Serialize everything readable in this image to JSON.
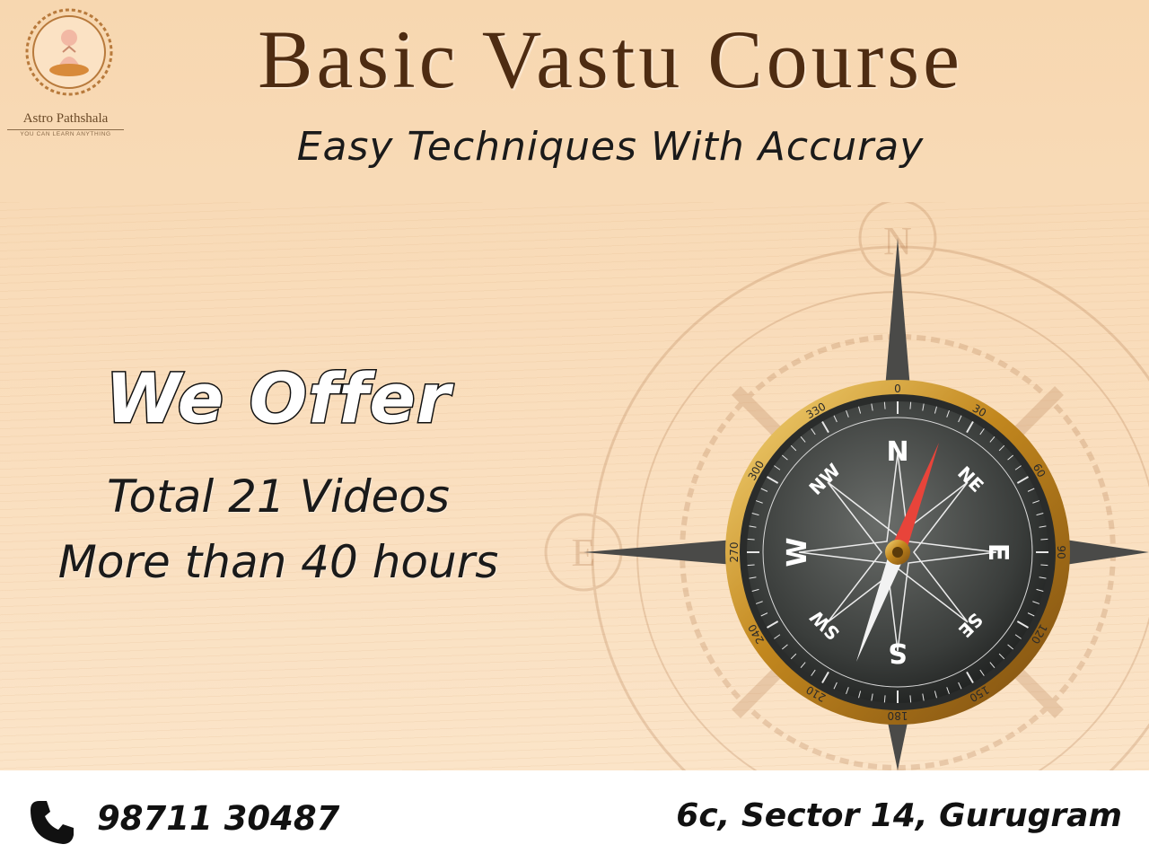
{
  "brand": {
    "name": "Astro Pathshala",
    "tagline": "YOU CAN LEARN ANYTHING"
  },
  "header": {
    "title": "Basic Vastu Course",
    "subtitle": "Easy Techniques With Accuray"
  },
  "offer": {
    "heading": "We Offer",
    "lines": [
      "Total 21 Videos",
      "More than 40 hours"
    ]
  },
  "compass": {
    "directions": [
      "N",
      "NE",
      "E",
      "SE",
      "S",
      "SW",
      "W",
      "NW"
    ],
    "degree_labels": [
      "0",
      "30",
      "60",
      "90",
      "120",
      "150",
      "180",
      "210",
      "240",
      "270",
      "300",
      "330"
    ],
    "background_letters": [
      "N",
      "E"
    ]
  },
  "footer": {
    "phone": "98711 30487",
    "address": "6c, Sector 14, Gurugram",
    "phone_icon": "phone-icon"
  },
  "colors": {
    "background": "#f8d9b4",
    "title": "#4e2c12",
    "compass_gold": "#c99a2e",
    "needle_red": "#e8443a"
  }
}
